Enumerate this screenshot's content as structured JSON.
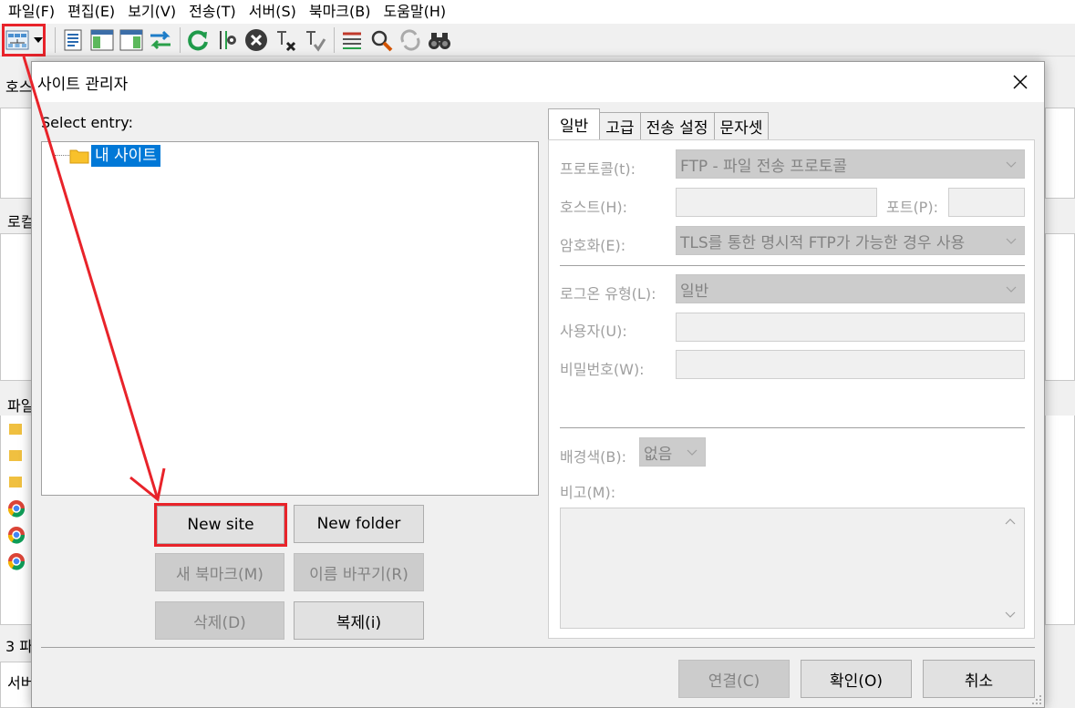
{
  "menu": [
    "파일(F)",
    "편집(E)",
    "보기(V)",
    "전송(T)",
    "서버(S)",
    "북마크(B)",
    "도움말(H)"
  ],
  "toolbar": {
    "icons": [
      "site-manager-icon",
      "site-manager-dropdown-icon",
      "message-log-icon",
      "local-tree-icon",
      "remote-tree-icon",
      "sync-browse-icon",
      "refresh-icon",
      "filter-icon",
      "cancel-icon",
      "disconnect-icon",
      "reconnect-icon",
      "compare-icon",
      "search-icon",
      "sync-icon",
      "find-icon"
    ]
  },
  "background": {
    "host_label": "호스",
    "local_label": "로컬",
    "file_label": "파일",
    "status_label": "3 파",
    "server_label": "서버"
  },
  "dialog": {
    "title": "사이트 관리자",
    "select_entry": "Select entry:",
    "tree_root": "내 사이트",
    "buttons": {
      "new_site": "New site",
      "new_folder": "New folder",
      "new_bookmark": "새 북마크(M)",
      "rename": "이름 바꾸기(R)",
      "delete": "삭제(D)",
      "duplicate": "복제(i)",
      "connect": "연결(C)",
      "ok": "확인(O)",
      "cancel": "취소"
    },
    "tabs": [
      "일반",
      "고급",
      "전송 설정",
      "문자셋"
    ],
    "general": {
      "protocol_label": "프로토콜(t):",
      "protocol_value": "FTP - 파일 전송 프로토콜",
      "host_label": "호스트(H):",
      "port_label": "포트(P):",
      "encryption_label": "암호화(E):",
      "encryption_value": "TLS를 통한 명시적 FTP가 가능한 경우 사용",
      "logon_label": "로그온 유형(L):",
      "logon_value": "일반",
      "user_label": "사용자(U):",
      "password_label": "비밀번호(W):",
      "bgcolor_label": "배경색(B):",
      "bgcolor_value": "없음",
      "comments_label": "비고(M):"
    }
  },
  "colors": {
    "highlight": "#e8232a",
    "selection": "#0078d7"
  }
}
